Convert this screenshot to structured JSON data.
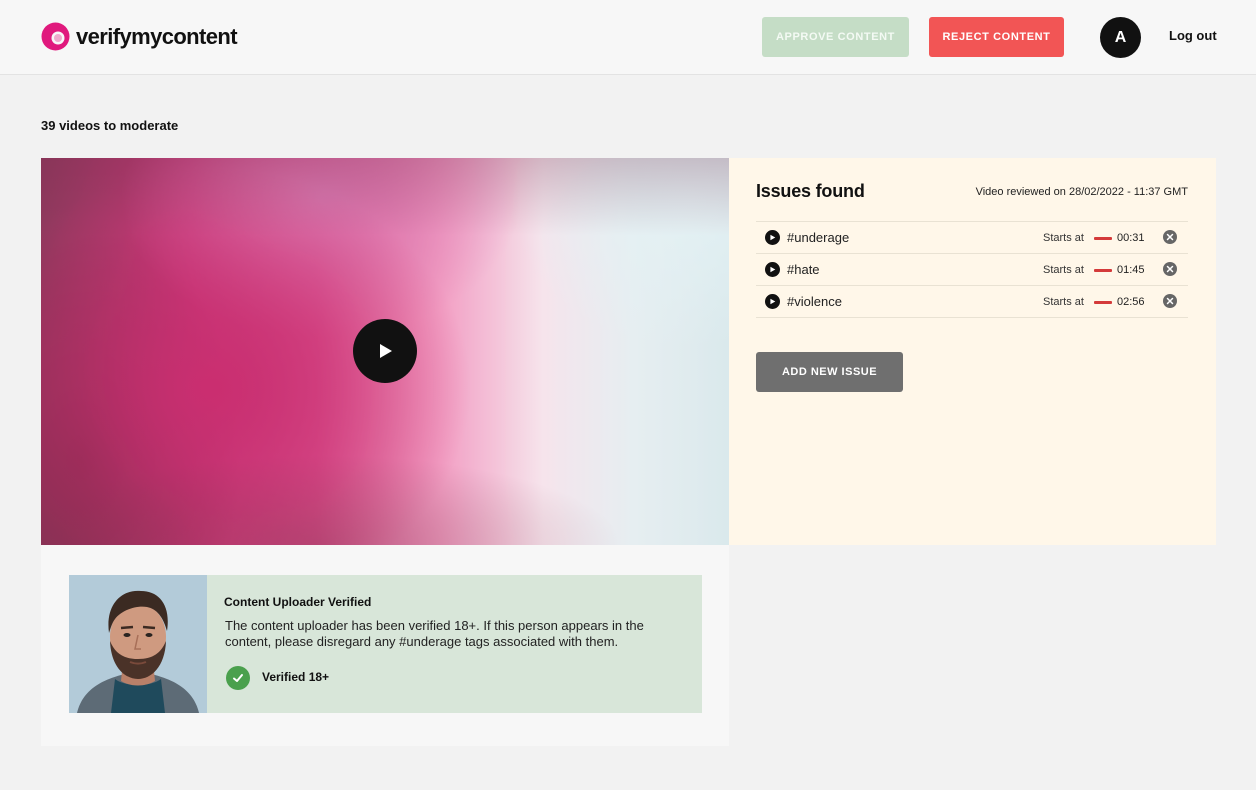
{
  "header": {
    "logo_text": "verifymycontent",
    "approve_label": "APPROVE CONTENT",
    "reject_label": "REJECT CONTENT",
    "avatar_initial": "A",
    "logout_label": "Log out"
  },
  "moderation": {
    "count_text": "39 videos to moderate"
  },
  "issues": {
    "title": "Issues found",
    "reviewed_text": "Video reviewed on 28/02/2022 - 11:37 GMT",
    "starts_label": "Starts at",
    "items": [
      {
        "tag": "#underage",
        "time": "00:31"
      },
      {
        "tag": "#hate",
        "time": "01:45"
      },
      {
        "tag": "#violence",
        "time": "02:56"
      }
    ],
    "add_label": "ADD NEW ISSUE"
  },
  "uploader": {
    "title": "Content Uploader Verified",
    "description": "The content uploader has been verified 18+. If this person appears in the content, please disregard any #underage tags associated with them.",
    "verified_label": "Verified 18+"
  },
  "colors": {
    "brand_pink": "#e0197d",
    "approve": "#c5ddc6",
    "reject": "#f25555",
    "verified_green": "#4aa04d"
  }
}
